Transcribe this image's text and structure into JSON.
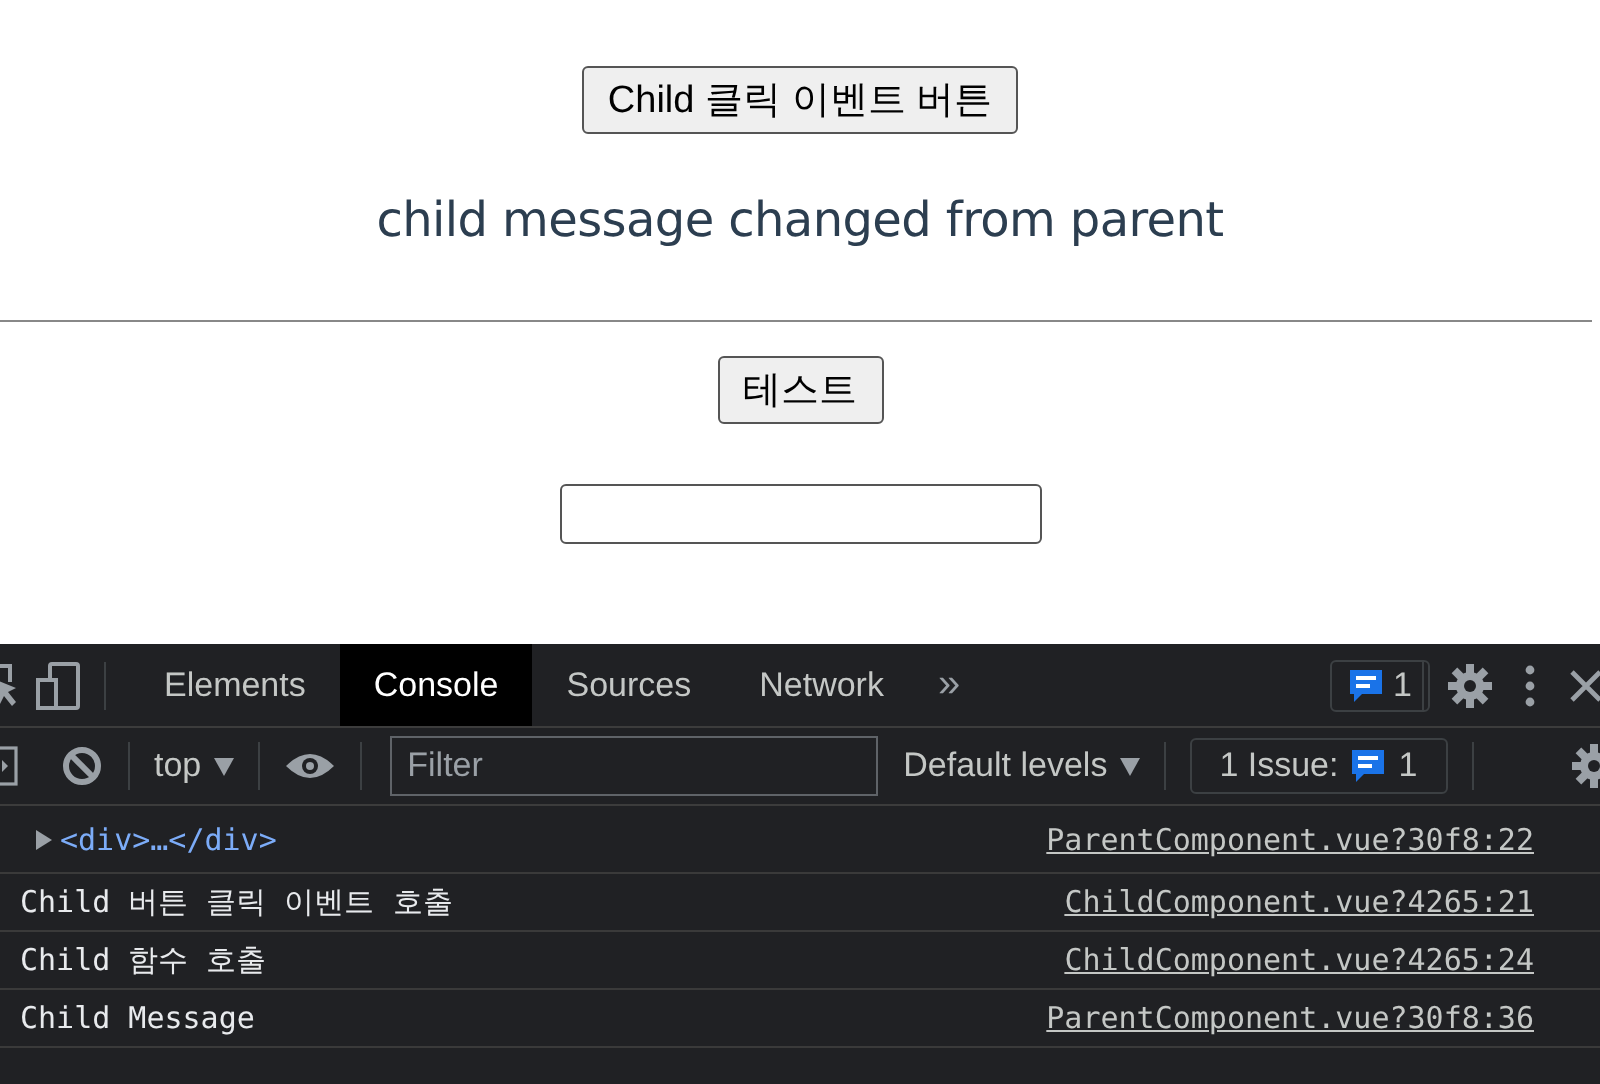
{
  "page": {
    "child_button": "Child 클릭 이벤트 버튼",
    "message": "child message changed from parent",
    "test_button": "테스트"
  },
  "devtools": {
    "tabs": [
      {
        "label": "Elements",
        "selected": false
      },
      {
        "label": "Console",
        "selected": true
      },
      {
        "label": "Sources",
        "selected": false
      },
      {
        "label": "Network",
        "selected": false
      }
    ],
    "more_tabs": "»",
    "messages_badge": "1",
    "context": "top",
    "filter": {
      "placeholder": "Filter"
    },
    "levels": "Default levels",
    "issues": {
      "label": "1 Issue:",
      "count": "1"
    },
    "console": [
      {
        "kind": "element",
        "text": "<div>…</div>",
        "source": "ParentComponent.vue?30f8:22"
      },
      {
        "kind": "log",
        "text": "Child 버튼 클릭 이벤트 호출",
        "source": "ChildComponent.vue?4265:21"
      },
      {
        "kind": "log",
        "text": "Child 함수 호출",
        "source": "ChildComponent.vue?4265:24"
      },
      {
        "kind": "log",
        "text": "Child Message",
        "source": "ParentComponent.vue?30f8:36"
      }
    ]
  }
}
